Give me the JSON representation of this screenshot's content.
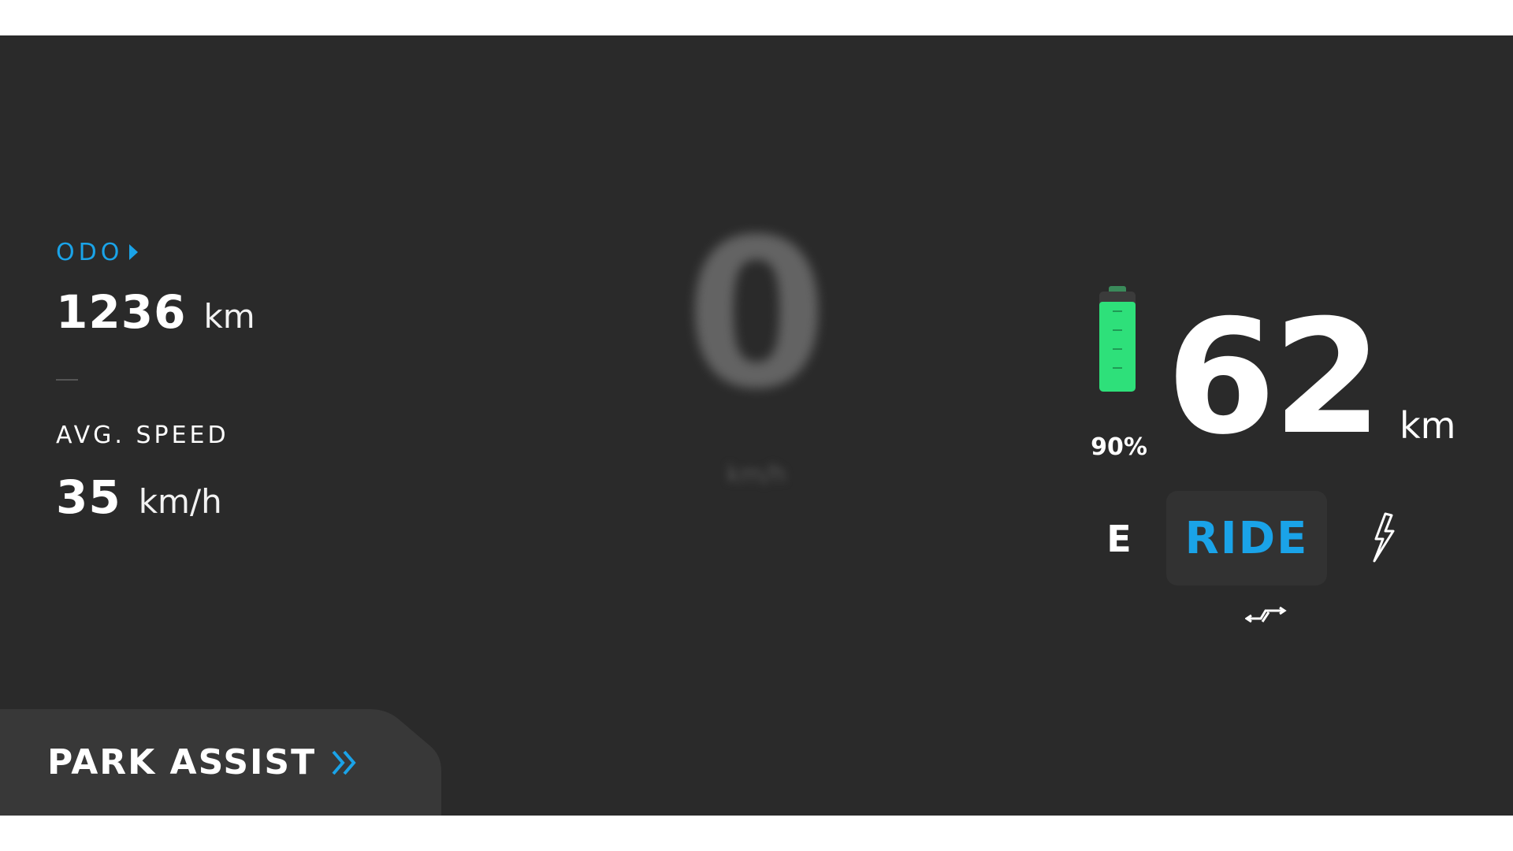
{
  "odometer": {
    "label": "ODO",
    "value": "1236",
    "unit": "km"
  },
  "average_speed": {
    "label": "AVG. SPEED",
    "value": "35",
    "unit": "km/h"
  },
  "current_speed": {
    "value": "0",
    "unit": "km/h"
  },
  "battery": {
    "percent_text": "90%",
    "level": 0.9,
    "fill_color": "#2ee07a"
  },
  "range": {
    "value": "62",
    "unit": "km"
  },
  "ride_mode": {
    "left_mode": "E",
    "active_mode": "RIDE",
    "right_mode_icon": "lightning-bolt-icon",
    "regen_icon": "regen-arrows-icon"
  },
  "park_assist": {
    "label": "PARK ASSIST",
    "icon": "double-chevron-right-icon"
  },
  "colors": {
    "accent": "#1aa3e8",
    "background": "#2a2a2a",
    "panel": "#383838",
    "text": "#ffffff"
  }
}
